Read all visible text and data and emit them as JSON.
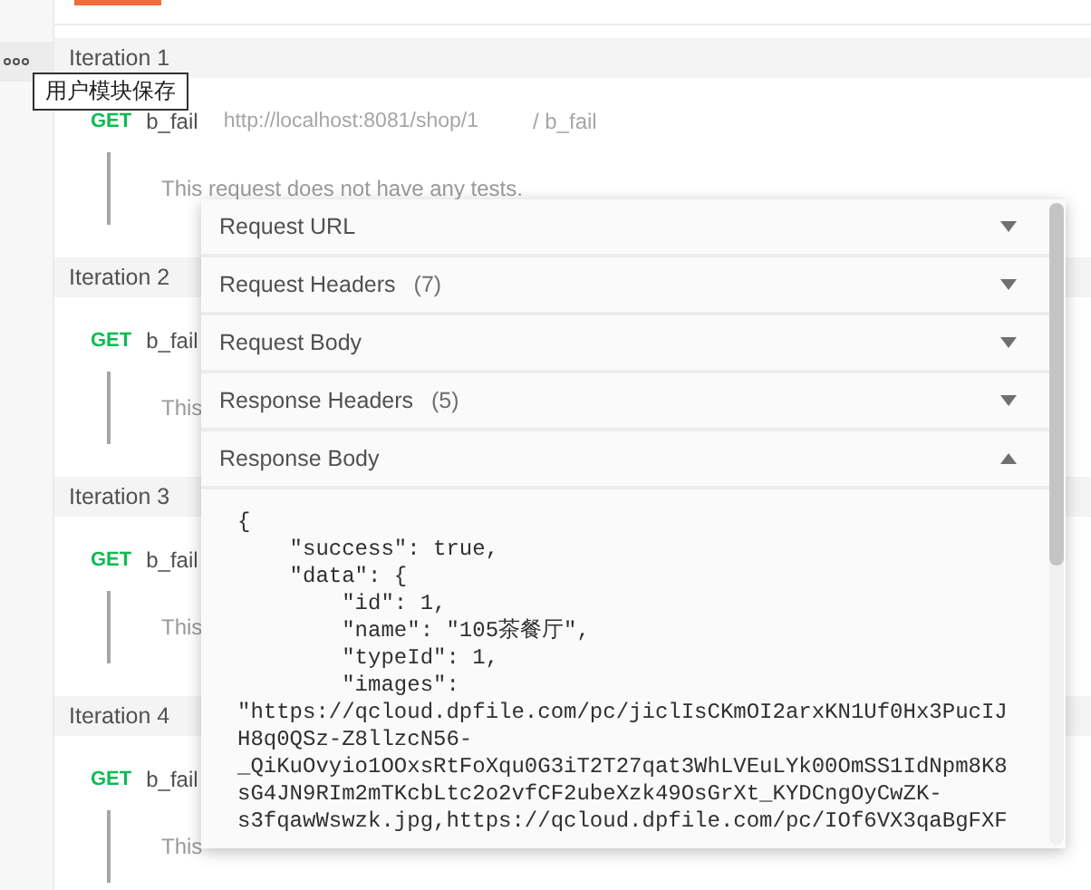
{
  "sidebar": {
    "tooltip": "用户模块保存"
  },
  "iterations": [
    {
      "title": "Iteration 1",
      "request": {
        "method": "GET",
        "name": "b_fail",
        "url": "http://localhost:8081/shop/1",
        "path": "/ b_fail"
      },
      "test_note": "This request does not have any tests."
    },
    {
      "title": "Iteration 2",
      "request": {
        "method": "GET",
        "name": "b_fail"
      },
      "test_note": "This"
    },
    {
      "title": "Iteration 3",
      "request": {
        "method": "GET",
        "name": "b_fail"
      },
      "test_note": "This"
    },
    {
      "title": "Iteration 4",
      "request": {
        "method": "GET",
        "name": "b_fail"
      },
      "test_note": "This"
    }
  ],
  "details": {
    "sections": [
      {
        "label": "Request URL",
        "expanded": false
      },
      {
        "label": "Request Headers",
        "count": "(7)",
        "expanded": false
      },
      {
        "label": "Request Body",
        "expanded": false
      },
      {
        "label": "Response Headers",
        "count": "(5)",
        "expanded": false
      },
      {
        "label": "Response Body",
        "expanded": true
      }
    ],
    "response_body": [
      "{",
      "    \"success\": true,",
      "    \"data\": {",
      "        \"id\": 1,",
      "        \"name\": \"105茶餐厅\",",
      "        \"typeId\": 1,",
      "        \"images\":",
      "\"https://qcloud.dpfile.com/pc/jiclIsCKmOI2arxKN1Uf0Hx3PucIJ",
      "H8q0QSz-Z8llzcN56-",
      "_QiKuOvyio1OOxsRtFoXqu0G3iT2T27qat3WhLVEuLYk00OmSS1IdNpm8K8",
      "sG4JN9RIm2mTKcbLtc2o2vfCF2ubeXzk49OsGrXt_KYDCngOyCwZK-",
      "s3fqawWswzk.jpg,https://qcloud.dpfile.com/pc/IOf6VX3qaBgFXF"
    ]
  }
}
